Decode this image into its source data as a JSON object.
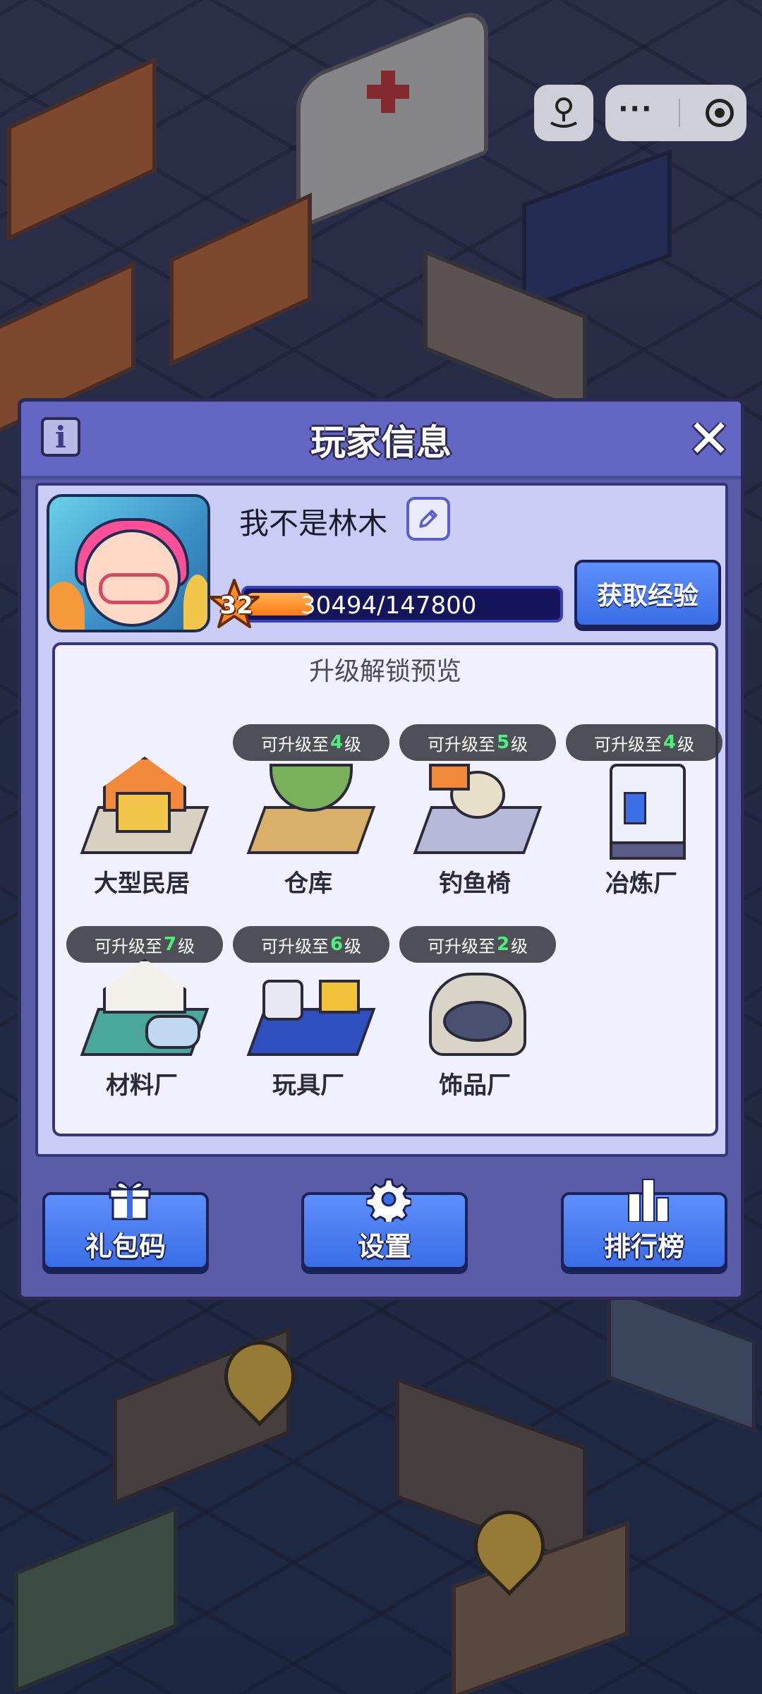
{
  "dialog": {
    "title": "玩家信息",
    "info_icon": "i",
    "close_icon": "✕"
  },
  "player": {
    "name": "我不是林木",
    "level": "32",
    "xp_text": "30494/147800",
    "xp_current": 30494,
    "xp_max": 147800,
    "get_exp_label": "获取经验"
  },
  "preview": {
    "title": "升级解锁预览",
    "items": [
      {
        "name": "大型民居",
        "badge": null
      },
      {
        "name": "仓库",
        "badge_prefix": "可升级至",
        "badge_level": "4",
        "badge_suffix": "级"
      },
      {
        "name": "钓鱼椅",
        "badge_prefix": "可升级至",
        "badge_level": "5",
        "badge_suffix": "级"
      },
      {
        "name": "冶炼厂",
        "badge_prefix": "可升级至",
        "badge_level": "4",
        "badge_suffix": "级"
      },
      {
        "name": "材料厂",
        "badge_prefix": "可升级至",
        "badge_level": "7",
        "badge_suffix": "级"
      },
      {
        "name": "玩具厂",
        "badge_prefix": "可升级至",
        "badge_level": "6",
        "badge_suffix": "级"
      },
      {
        "name": "饰品厂",
        "badge_prefix": "可升级至",
        "badge_level": "2",
        "badge_suffix": "级"
      }
    ]
  },
  "bottom": {
    "gift_code": "礼包码",
    "settings": "设置",
    "leaderboard": "排行榜"
  },
  "capsule": {
    "more": "···"
  },
  "colors": {
    "dialog_bg": "#5a5ca8",
    "panel_bg": "#c9cdf6",
    "button_blue": "#3a6de6",
    "badge_level_green": "#4cf07a",
    "xp_fill_orange": "#ff7a14"
  }
}
